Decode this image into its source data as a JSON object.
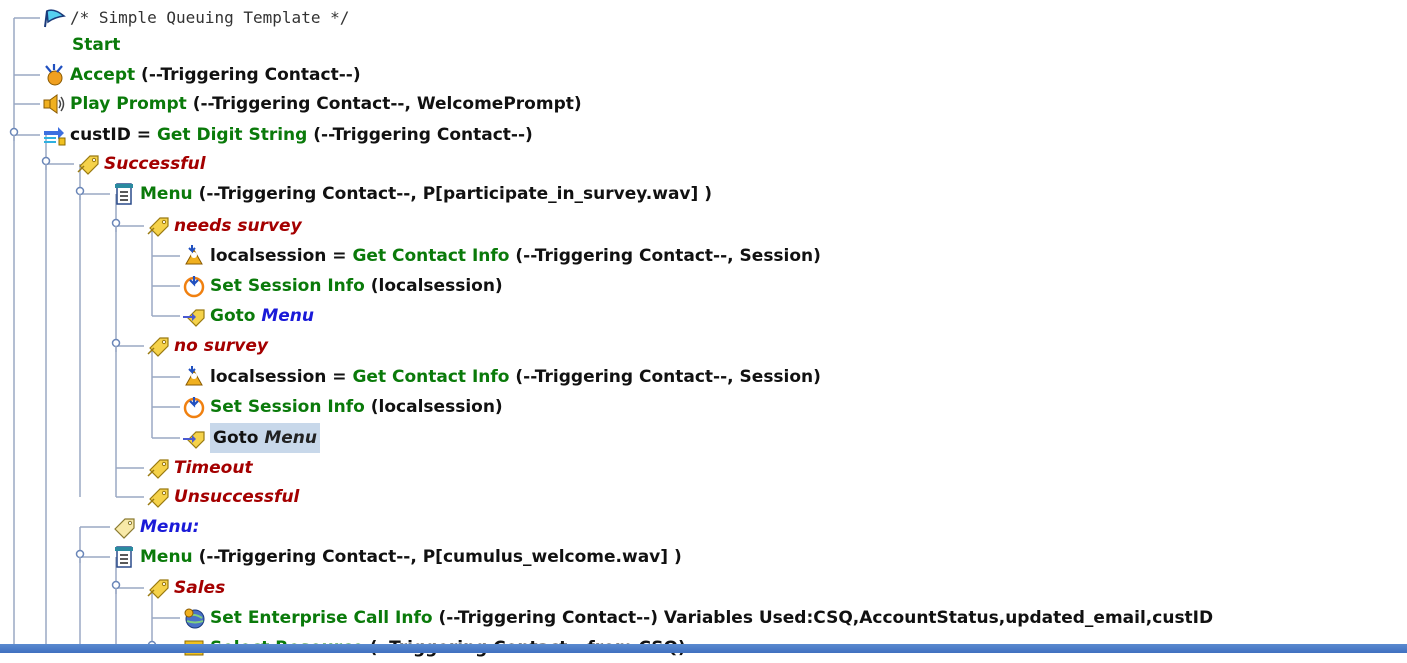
{
  "tree": {
    "rows": [
      {
        "icon": "flag-icon",
        "parts": [
          {
            "cls": "cmt",
            "t": "/* Simple Queuing Template */"
          }
        ]
      },
      {
        "icon": "",
        "parts": [
          {
            "cls": "kw",
            "t": "Start"
          }
        ]
      },
      {
        "icon": "accept-icon",
        "parts": [
          {
            "cls": "kw",
            "t": "Accept"
          },
          {
            "cls": "txt",
            "t": " (--Triggering Contact--)"
          }
        ]
      },
      {
        "icon": "speaker-icon",
        "parts": [
          {
            "cls": "kw",
            "t": "Play Prompt"
          },
          {
            "cls": "txt",
            "t": " (--Triggering Contact--, WelcomePrompt)"
          }
        ]
      },
      {
        "icon": "digit-string-icon",
        "parts": [
          {
            "cls": "txt",
            "t": "custID = "
          },
          {
            "cls": "kw",
            "t": "Get Digit String"
          },
          {
            "cls": "txt",
            "t": " (--Triggering Contact--)"
          }
        ]
      },
      {
        "icon": "branch-tag-icon",
        "parts": [
          {
            "cls": "label",
            "t": "Successful"
          }
        ]
      },
      {
        "icon": "menu-icon",
        "parts": [
          {
            "cls": "kw",
            "t": "Menu"
          },
          {
            "cls": "txt",
            "t": " (--Triggering Contact--, P[participate_in_survey.wav] )"
          }
        ]
      },
      {
        "icon": "branch-tag-icon",
        "parts": [
          {
            "cls": "label",
            "t": "needs survey"
          }
        ]
      },
      {
        "icon": "contact-info-icon",
        "parts": [
          {
            "cls": "txt",
            "t": "localsession = "
          },
          {
            "cls": "kw",
            "t": "Get Contact Info"
          },
          {
            "cls": "txt",
            "t": " (--Triggering Contact--, Session)"
          }
        ]
      },
      {
        "icon": "session-icon",
        "parts": [
          {
            "cls": "kw",
            "t": "Set Session Info"
          },
          {
            "cls": "txt",
            "t": " (localsession)"
          }
        ]
      },
      {
        "icon": "goto-icon",
        "parts": [
          {
            "cls": "kw",
            "t": "Goto "
          },
          {
            "cls": "lbl",
            "t": "Menu"
          }
        ]
      },
      {
        "icon": "branch-tag-icon",
        "parts": [
          {
            "cls": "label",
            "t": "no survey"
          }
        ]
      },
      {
        "icon": "contact-info-icon",
        "parts": [
          {
            "cls": "txt",
            "t": "localsession = "
          },
          {
            "cls": "kw",
            "t": "Get Contact Info"
          },
          {
            "cls": "txt",
            "t": " (--Triggering Contact--, Session)"
          }
        ]
      },
      {
        "icon": "session-icon",
        "parts": [
          {
            "cls": "kw",
            "t": "Set Session Info"
          },
          {
            "cls": "txt",
            "t": " (localsession)"
          }
        ]
      },
      {
        "icon": "goto-icon",
        "selected": true,
        "parts": [
          {
            "cls": "txt",
            "t": "Goto "
          },
          {
            "cls": "lbl-sel",
            "t": "Menu"
          }
        ]
      },
      {
        "icon": "branch-tag-icon",
        "parts": [
          {
            "cls": "label",
            "t": "Timeout"
          }
        ]
      },
      {
        "icon": "branch-tag-icon",
        "parts": [
          {
            "cls": "label",
            "t": "Unsuccessful"
          }
        ]
      },
      {
        "icon": "label-tag-icon",
        "parts": [
          {
            "cls": "lbl",
            "t": "Menu:"
          }
        ]
      },
      {
        "icon": "menu-icon",
        "parts": [
          {
            "cls": "kw",
            "t": "Menu"
          },
          {
            "cls": "txt",
            "t": " (--Triggering Contact--, P[cumulus_welcome.wav] )"
          }
        ]
      },
      {
        "icon": "branch-tag-icon",
        "parts": [
          {
            "cls": "label",
            "t": "Sales"
          }
        ]
      },
      {
        "icon": "enterprise-icon",
        "parts": [
          {
            "cls": "kw",
            "t": "Set Enterprise Call Info"
          },
          {
            "cls": "txt",
            "t": " (--Triggering Contact--) Variables Used:CSQ,AccountStatus,updated_email,custID"
          }
        ]
      },
      {
        "icon": "select-resource-icon",
        "parts": [
          {
            "cls": "kw",
            "t": "Select Resource"
          },
          {
            "cls": "txt",
            "t": " (--Triggering Contact-- from CSQ)"
          }
        ]
      }
    ]
  },
  "colors": {
    "step": "#0a7a0a",
    "branch_label": "#a40000",
    "goto_label": "#1a1ad8",
    "selection": "#c8d8ea",
    "tree_line": "#9aa8c4",
    "bottom_bar": "#4a7cc9"
  }
}
